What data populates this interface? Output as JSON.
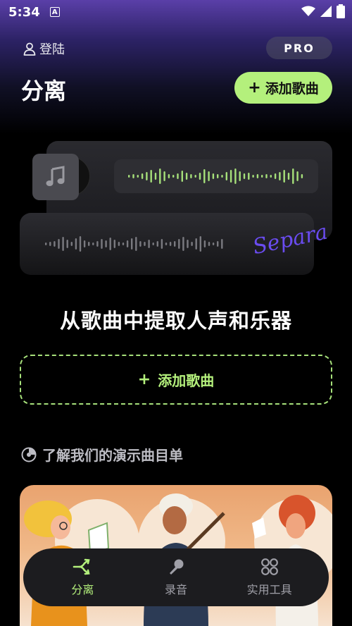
{
  "status_bar": {
    "time": "5:34",
    "notification_letter": "A"
  },
  "header": {
    "login_label": "登陆",
    "pro_label": "PRO"
  },
  "page": {
    "title": "分离",
    "add_button_label": "添加歌曲"
  },
  "illustration": {
    "script_text": "Separate"
  },
  "main": {
    "headline": "从歌曲中提取人声和乐器",
    "add_box_label": "添加歌曲",
    "demo_section_label": "了解我们的演示曲目单"
  },
  "bottom_nav": {
    "items": [
      {
        "label": "分离",
        "icon": "split-icon",
        "active": true
      },
      {
        "label": "录音",
        "icon": "microphone-icon",
        "active": false
      },
      {
        "label": "实用工具",
        "icon": "tools-grid-icon",
        "active": false
      }
    ]
  },
  "colors": {
    "accent_green": "#b4f07c",
    "purple_script": "#6a4cf0",
    "background": "#000000"
  }
}
